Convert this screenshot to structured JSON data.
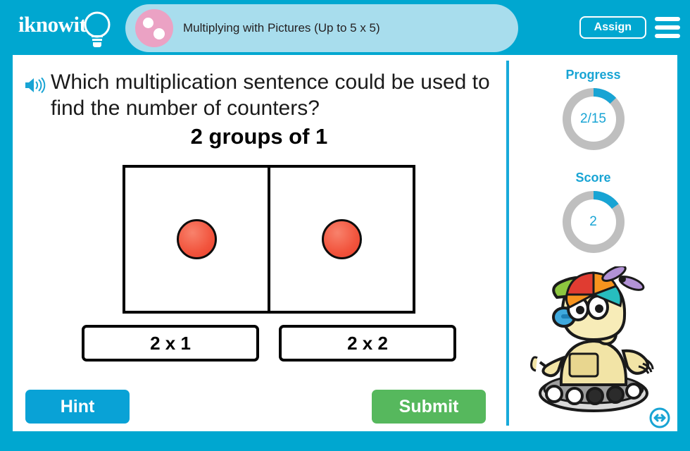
{
  "header": {
    "logo_text": "iknowit",
    "logo_icon": "lightbulb-icon",
    "subject_icon": "pink-counters-icon",
    "lesson_title": "Multiplying with Pictures (Up to 5 x 5)",
    "assign_label": "Assign",
    "menu_icon": "hamburger-menu-icon",
    "brand_color": "#00a7d0",
    "pill_color": "#a8dded",
    "subject_dot_color": "#eba2c4"
  },
  "question": {
    "audio_icon": "speaker-icon",
    "text": "Which multiplication sentence could be used to find the number of counters?",
    "prompt": "2 groups of 1"
  },
  "diagram": {
    "type": "equal-groups-counters",
    "groups": 2,
    "counters_per_group": 1,
    "total_counters": 2,
    "counter_color": "#f2553e",
    "box_border_color": "#000000"
  },
  "choices": [
    {
      "label": "2 x 1",
      "selected": false
    },
    {
      "label": "2 x 2",
      "selected": false
    }
  ],
  "actions": {
    "hint_label": "Hint",
    "hint_color": "#09a2d6",
    "submit_label": "Submit",
    "submit_color": "#56b85d"
  },
  "sidebar": {
    "progress": {
      "label": "Progress",
      "value_text": "2/15",
      "current": 2,
      "total": 15,
      "percent": 13,
      "arc_color": "#18a4d4",
      "track_color": "#bfbfbf"
    },
    "score": {
      "label": "Score",
      "value_text": "2",
      "current": 2,
      "percent": 15,
      "arc_color": "#18a4d4",
      "track_color": "#bfbfbf"
    },
    "mascot_icon": "robot-mascot-propeller-hat",
    "next_icon": "left-right-arrow-icon"
  }
}
